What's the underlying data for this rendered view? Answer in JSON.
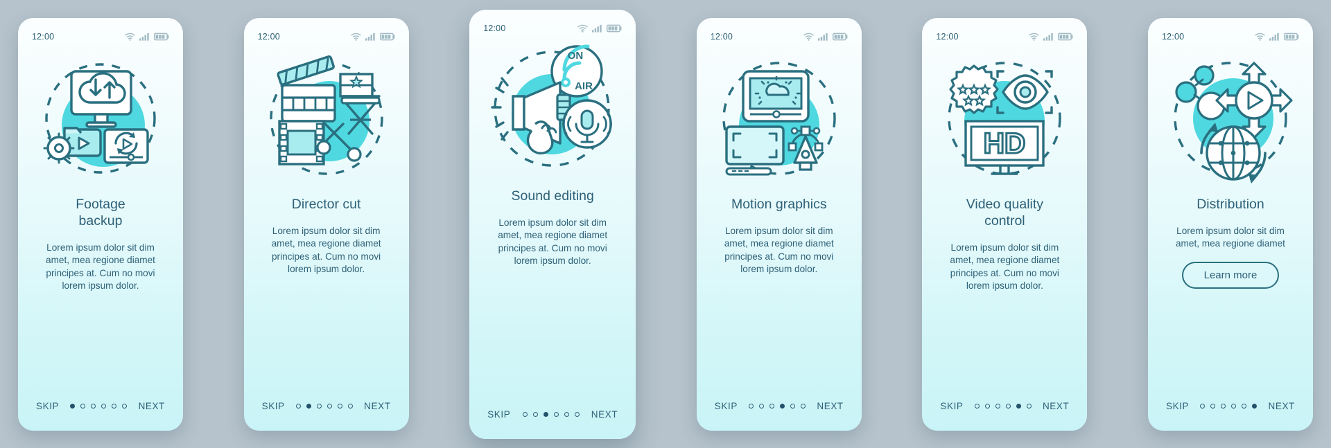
{
  "meta": {
    "background_color": "#b6c3cc",
    "accent_color": "#4fd8e0",
    "stroke_color": "#2a6f80",
    "text_color": "#2e6077"
  },
  "status_bar": {
    "time": "12:00",
    "icons": [
      "wifi-icon",
      "cellular-signal-icon",
      "battery-icon"
    ]
  },
  "nav": {
    "skip_label": "SKIP",
    "next_label": "NEXT",
    "dot_count": 6
  },
  "body_text": "Lorem ipsum dolor sit dim\namet, mea regione diamet\nprincipes at. Cum no movi\nlorem ipsum dolor.",
  "body_text_short": "Lorem ipsum dolor sit dim\namet, mea regione diamet",
  "cards": [
    {
      "title": "Footage\nbackup",
      "desc": "Lorem ipsum dolor sit dim\namet, mea regione diamet\nprincipes at. Cum no movi\nlorem ipsum dolor.",
      "active_dot": 0,
      "illustration": "cloud-backup-illustration",
      "elevated": false,
      "button": null
    },
    {
      "title": "Director cut",
      "desc": "Lorem ipsum dolor sit dim\namet, mea regione diamet\nprincipes at. Cum no movi\nlorem ipsum dolor.",
      "active_dot": 1,
      "illustration": "clapperboard-director-chair-illustration",
      "elevated": false,
      "button": null
    },
    {
      "title": "Sound editing",
      "desc": "Lorem ipsum dolor sit dim\namet, mea regione diamet\nprincipes at. Cum no movi\nlorem ipsum dolor.",
      "active_dot": 2,
      "illustration": "megaphone-on-air-microphone-illustration",
      "elevated": true,
      "button": null
    },
    {
      "title": "Motion graphics",
      "desc": "Lorem ipsum dolor sit dim\namet, mea regione diamet\nprincipes at. Cum no movi\nlorem ipsum dolor.",
      "active_dot": 3,
      "illustration": "monitor-tablet-pen-illustration",
      "elevated": false,
      "button": null
    },
    {
      "title": "Video quality\ncontrol",
      "desc": "Lorem ipsum dolor sit dim\namet, mea regione diamet\nprincipes at. Cum no movi\nlorem ipsum dolor.",
      "active_dot": 4,
      "illustration": "hd-eye-stars-illustration",
      "elevated": false,
      "button": null
    },
    {
      "title": "Distribution",
      "desc": "Lorem ipsum dolor sit dim\namet, mea regione diamet",
      "active_dot": 5,
      "illustration": "globe-share-arrows-illustration",
      "elevated": false,
      "button": "Learn more"
    }
  ]
}
